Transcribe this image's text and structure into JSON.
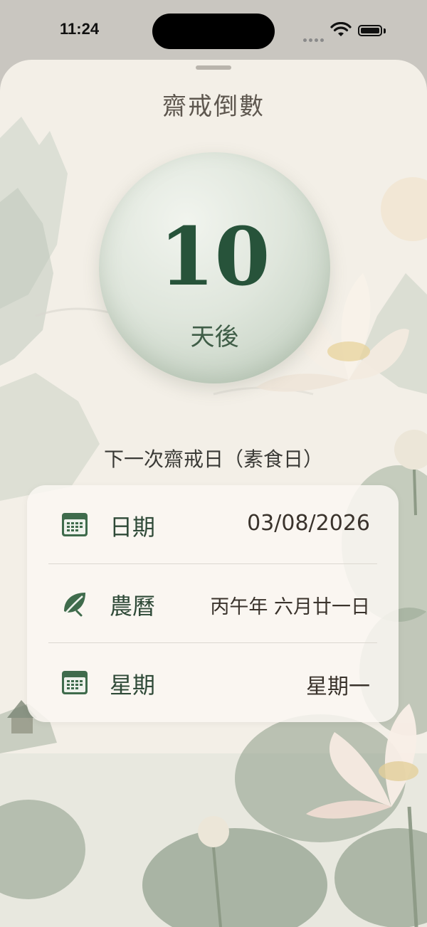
{
  "status_bar": {
    "time": "11:24"
  },
  "sheet": {
    "title": "齋戒倒數",
    "countdown": {
      "number": "10",
      "unit": "天後"
    },
    "subtitle": "下一次齋戒日（素食日）",
    "details": [
      {
        "icon": "calendar-icon",
        "label": "日期",
        "value": "03/08/2026"
      },
      {
        "icon": "leaf-icon",
        "label": "農曆",
        "value": "丙午年 六月廿一日"
      },
      {
        "icon": "calendar-icon",
        "label": "星期",
        "value": "星期一"
      }
    ]
  },
  "colors": {
    "accent_green": "#27533a",
    "icon_green": "#3f6b4c",
    "background": "#f3efe7"
  }
}
